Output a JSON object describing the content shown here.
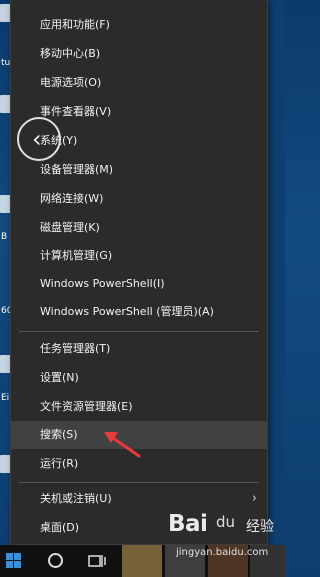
{
  "menu": {
    "items": [
      {
        "label": "应用和功能(F)"
      },
      {
        "label": "移动中心(B)"
      },
      {
        "label": "电源选项(O)"
      },
      {
        "label": "事件查看器(V)"
      },
      {
        "label": "系统(Y)"
      },
      {
        "label": "设备管理器(M)"
      },
      {
        "label": "网络连接(W)"
      },
      {
        "label": "磁盘管理(K)"
      },
      {
        "label": "计算机管理(G)"
      },
      {
        "label": "Windows PowerShell(I)"
      },
      {
        "label": "Windows PowerShell (管理员)(A)"
      },
      {
        "label": "任务管理器(T)"
      },
      {
        "label": "设置(N)"
      },
      {
        "label": "文件资源管理器(E)"
      },
      {
        "label": "搜索(S)"
      },
      {
        "label": "运行(R)"
      },
      {
        "label": "关机或注销(U)"
      },
      {
        "label": "桌面(D)"
      }
    ],
    "highlighted_item": "搜索(S)",
    "submenu_arrow": "›"
  },
  "back_button": {
    "icon": "chevron-left-icon",
    "glyph": "‹"
  },
  "desktop_edge_text": {
    "t1": "tu",
    "t2": "B",
    "t3": "60",
    "t4": "Ei"
  },
  "taskbar": {
    "start_icon": "windows-logo-icon",
    "search_icon": "circle-search-icon",
    "task_view_icon": "task-view-icon",
    "accent_colors": [
      "#c8a35a",
      "#6b6b6b",
      "#8b5a3c",
      "#4a4a4a"
    ]
  },
  "watermark": {
    "logo": "Bai",
    "paw": "du",
    "brand": "经验",
    "url": "jingyan.baidu.com"
  },
  "annotation": {
    "arrow_color": "#e83a3a"
  }
}
